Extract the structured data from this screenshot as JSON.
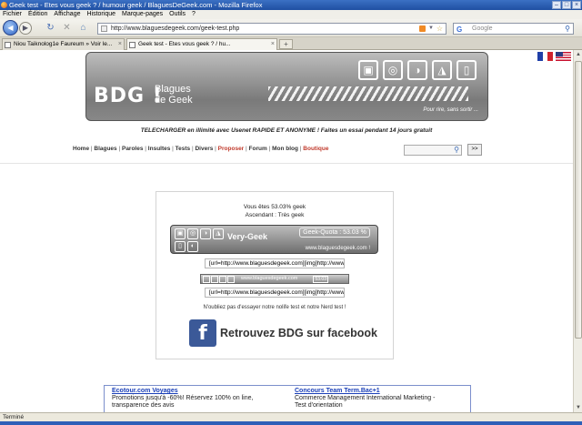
{
  "window": {
    "title": "Geek test - Etes vous geek ? / humour geek / BlaguesDeGeek.com - Mozilla Firefox"
  },
  "menu": [
    "Fichier",
    "Édition",
    "Affichage",
    "Historique",
    "Marque-pages",
    "Outils",
    "?"
  ],
  "nav": {
    "url": "http://www.blaguesdegeek.com/geek-test.php",
    "search_placeholder": "Google"
  },
  "tabs": [
    {
      "label": "Niou Taiknolog1e Faureum » Voir le..."
    },
    {
      "label": "Geek test - Etes vous geek ? / hu..."
    }
  ],
  "banner": {
    "logo": "BDG !",
    "logo_sub_1": "Blagues",
    "logo_sub_2": "de Geek",
    "slogan": "Pour rire, sans sortir ..."
  },
  "promo": "TELECHARGER en illimité avec Usenet RAPIDE ET ANONYME ! Faites un essai pendant 14 jours gratuit",
  "site_menu": {
    "home": "Home",
    "blagues": "Blagues",
    "paroles": "Paroles",
    "insultes": "Insultes",
    "tests": "Tests",
    "divers": "Divers",
    "proposer": "Proposer",
    "forum": "Forum",
    "blog": "Mon blog",
    "boutique": "Boutique",
    "go": ">>"
  },
  "result": {
    "score_line": "Vous êtes 53.03% geek",
    "ascendant_line": "Ascendant : Très geek",
    "banner_label": "Very-Geek",
    "quota_label": "Geek-Quota : 53.03 %",
    "banner_url": "www.blaguesdegeek.com !",
    "code_1": "[url=http://www.blaguesdegeek.com][img]http://www.blaguesdegeek.com/",
    "small_banner_url": "www.blaguesdegeek.com",
    "small_banner_pct": "53.03",
    "code_2": "[url=http://www.blaguesdegeek.com][img]http://www.blaguesdegeek.com/",
    "nolife": "N'oubliez pas d'essayer notre nolife test et notre Nerd test !",
    "facebook": "Retrouvez BDG sur facebook"
  },
  "ads": [
    {
      "title": "Ecotour.com Voyages",
      "line1": "Promotions jusqu'à -60%! Réservez 100% on line,",
      "line2": "transparence des avis"
    },
    {
      "title": "Concours Team Term.Bac+1",
      "line1": "Commerce Management International Marketing -",
      "line2": "Test d'orientation"
    }
  ],
  "status": "Terminé",
  "colors": {
    "accent": "#1a3fb8",
    "facebook": "#3b5998",
    "title_bar": "#2a5bb0"
  }
}
